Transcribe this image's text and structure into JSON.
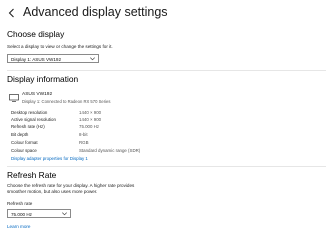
{
  "header": {
    "title": "Advanced display settings"
  },
  "choose_display": {
    "heading": "Choose display",
    "description": "Select a display to view or change the settings for it.",
    "selected": "Display 1: ASUS VW192"
  },
  "display_info": {
    "heading": "Display information",
    "monitor_name": "ASUS VW192",
    "monitor_subtitle": "Display 1: Connected to Radeon RX 570 Series",
    "rows": [
      {
        "label": "Desktop resolution",
        "value": "1440 × 900"
      },
      {
        "label": "Active signal resolution",
        "value": "1440 × 900"
      },
      {
        "label": "Refresh rate (Hz)",
        "value": "75.000 Hz"
      },
      {
        "label": "Bit depth",
        "value": "8-bit"
      },
      {
        "label": "Colour format",
        "value": "RGB"
      },
      {
        "label": "Colour space",
        "value": "Standard dynamic range (SDR)"
      }
    ],
    "adapter_link": "Display adapter properties for Display 1"
  },
  "refresh_rate": {
    "heading": "Refresh Rate",
    "description_line1": "Choose the refresh rate for your display. A higher rate provides",
    "description_line2": "smoother motion, but also uses more power.",
    "field_label": "Refresh rate",
    "selected": "75.000 Hz",
    "learn_more": "Learn more"
  },
  "colors": {
    "link": "#0067c0",
    "divider": "#e6e6e6"
  }
}
